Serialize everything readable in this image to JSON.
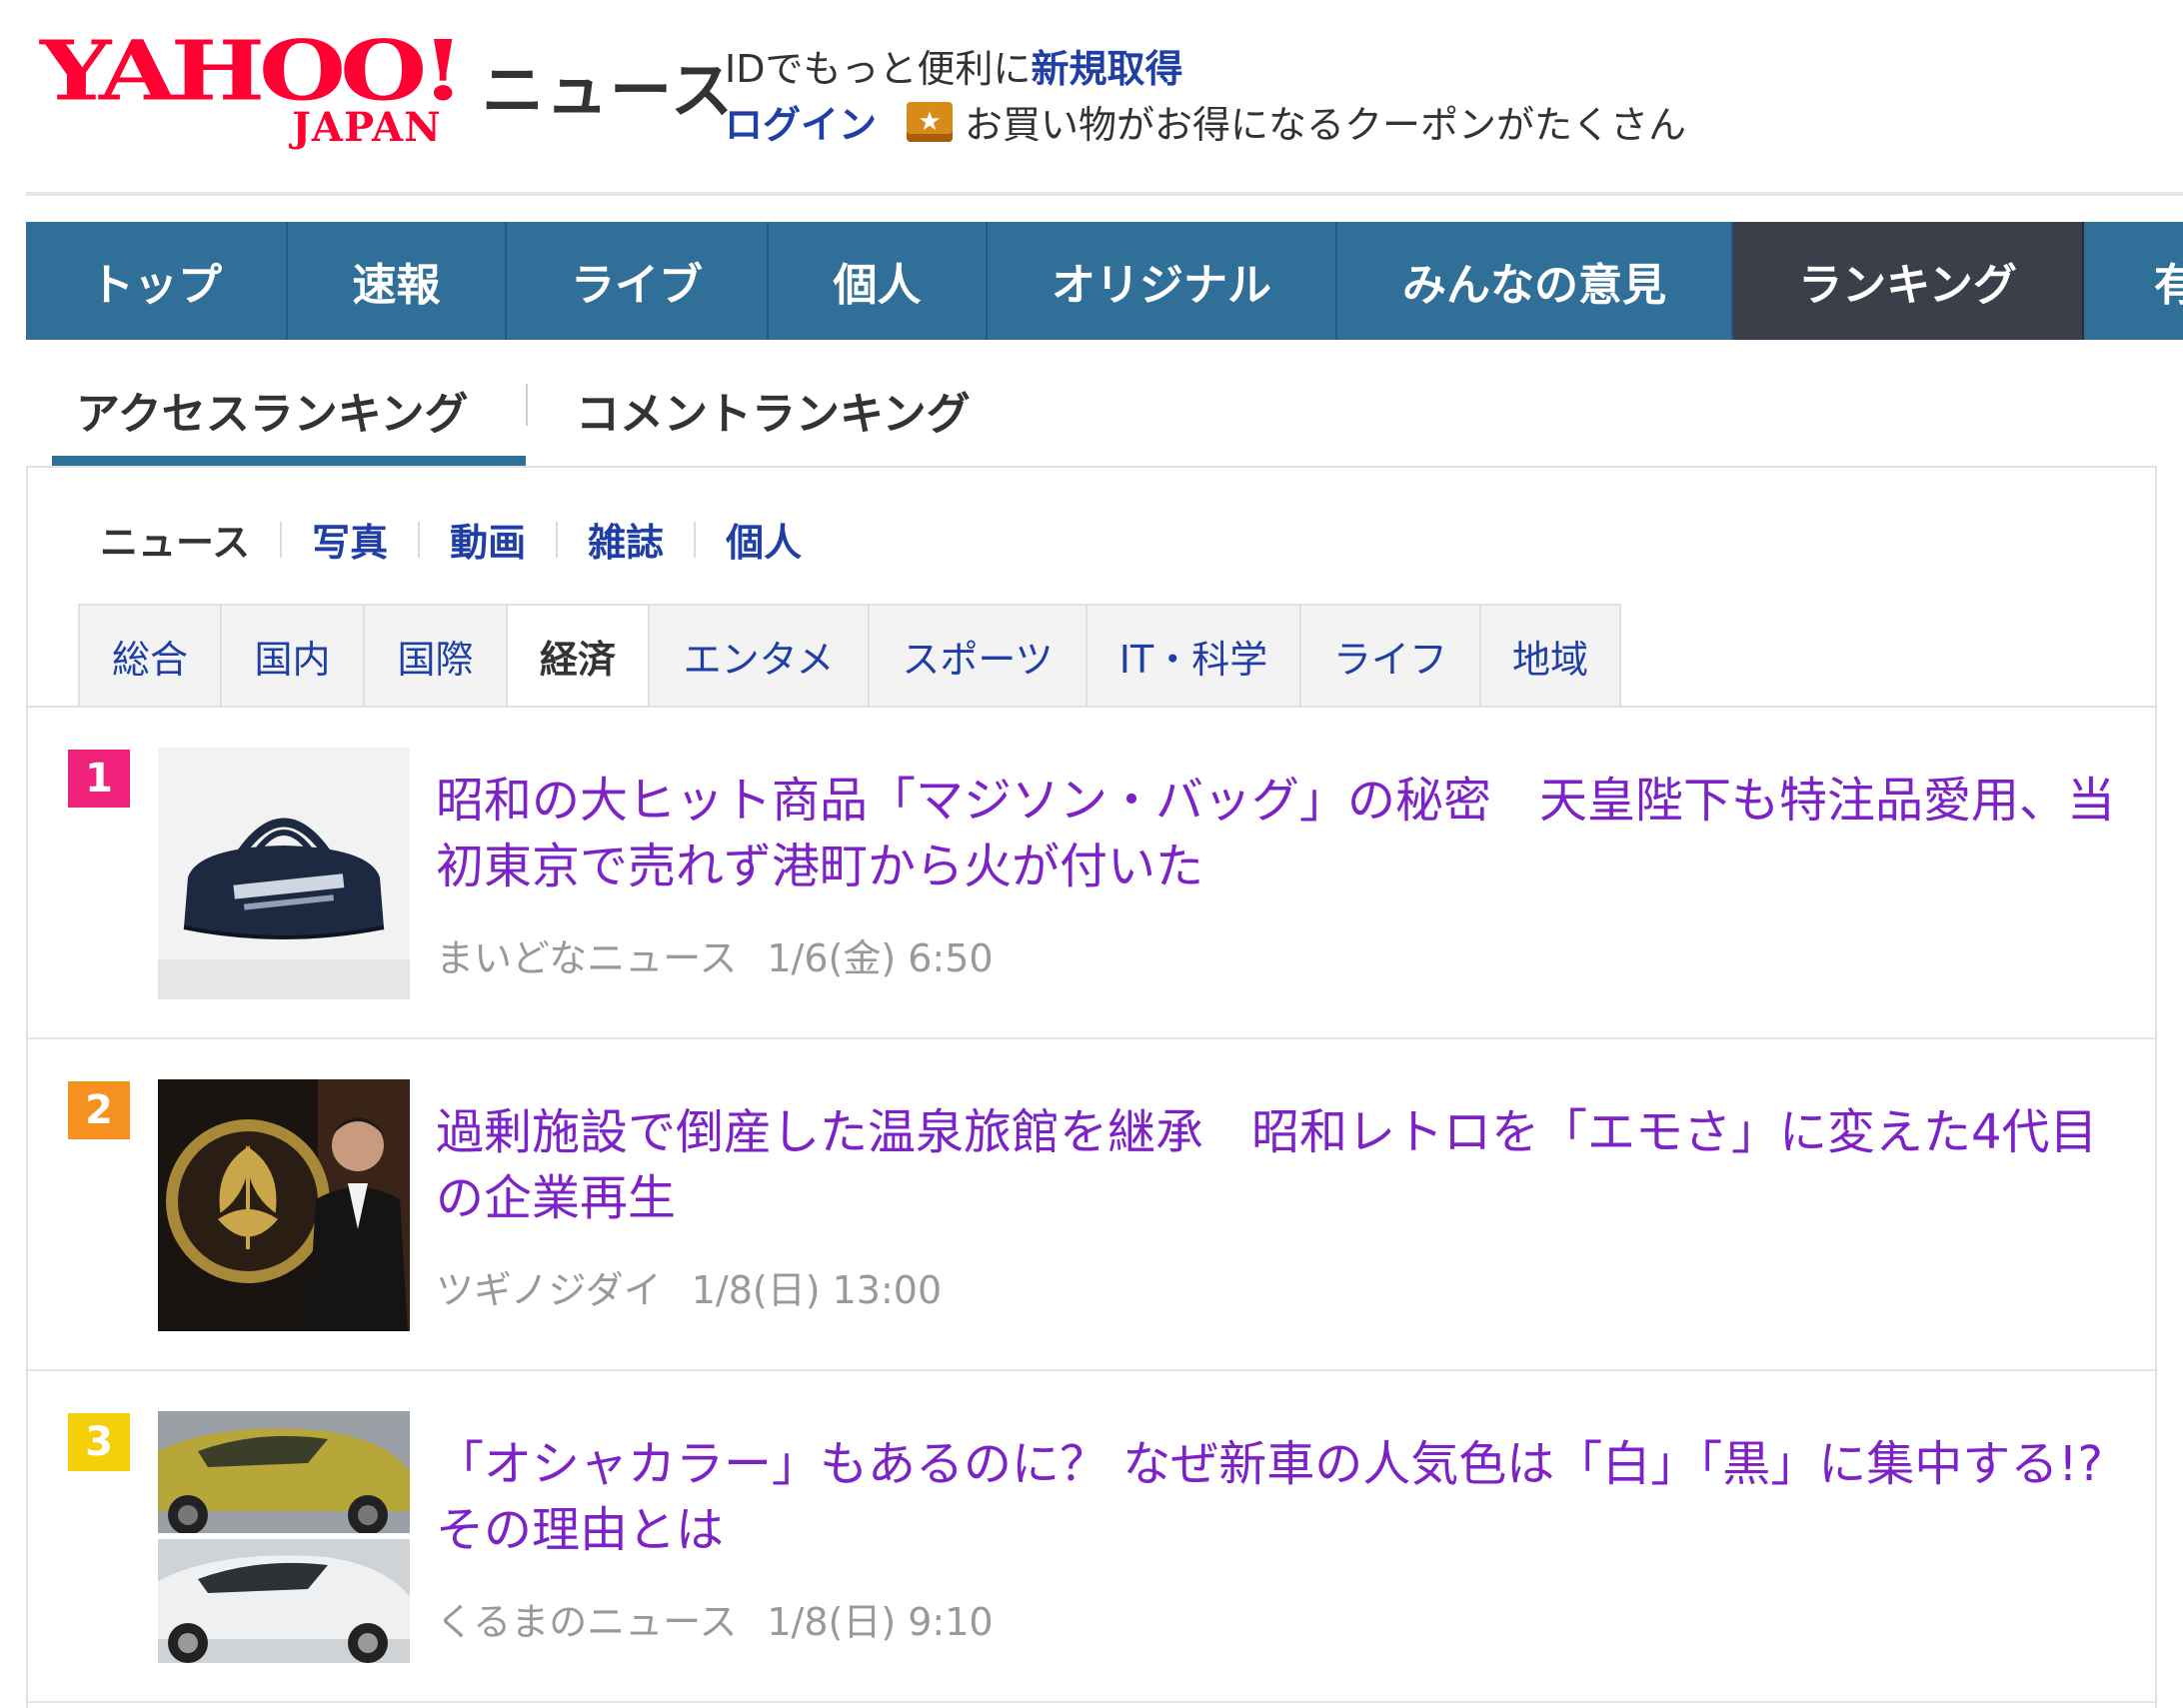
{
  "header": {
    "logo_text": "YAHOO!",
    "logo_sub": "JAPAN",
    "service_name": "ニュース",
    "promo_line1_prefix": "IDでもっと便利に",
    "promo_line1_link": "新規取得",
    "login_label": "ログイン",
    "coupon_text": "お買い物がお得になるクーポンがたくさん"
  },
  "gnav": {
    "items": [
      "トップ",
      "速報",
      "ライブ",
      "個人",
      "オリジナル",
      "みんなの意見",
      "ランキング",
      "有"
    ],
    "active": "ランキング"
  },
  "ranking_tabs": [
    "アクセスランキング",
    "コメントランキング"
  ],
  "sub_filter": [
    "ニュース",
    "写真",
    "動画",
    "雑誌",
    "個人"
  ],
  "categories": [
    "総合",
    "国内",
    "国際",
    "経済",
    "エンタメ",
    "スポーツ",
    "IT・科学",
    "ライフ",
    "地域"
  ],
  "active_category": "経済",
  "colors": {
    "logo_red": "#ff0033",
    "nav_blue": "#2f6f98",
    "nav_active": "#3b3f4a",
    "link_blue": "#1f3fa6",
    "visited_purple": "#7c22c7",
    "rank1": "#f0217a",
    "rank2": "#f5911e",
    "rank3": "#f5cf0a"
  },
  "articles": [
    {
      "rank": "1",
      "title": "昭和の大ヒット商品「マジソン・バッグ」の秘密　天皇陛下も特注品愛用、当初東京で売れず港町から火が付いた",
      "source": "まいどなニュース",
      "date": "1/6(金) 6:50",
      "thumb_icon": "bag-photo"
    },
    {
      "rank": "2",
      "title": "過剰施設で倒産した温泉旅館を継承　昭和レトロを「エモさ」に変えた4代目の企業再生",
      "source": "ツギノジダイ",
      "date": "1/8(日) 13:00",
      "thumb_icon": "man-with-crest-photo"
    },
    {
      "rank": "3",
      "title": "「オシャカラー」もあるのに？ なぜ新車の人気色は「白」「黒」に集中する!? その理由とは",
      "source": "くるまのニュース",
      "date": "1/8(日) 9:10",
      "thumb_icon": "cars-photo"
    }
  ]
}
